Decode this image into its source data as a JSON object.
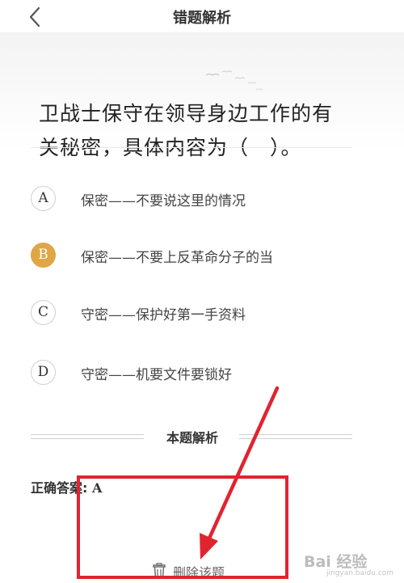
{
  "header": {
    "title": "错题解析",
    "back_icon": "chevron-left-icon"
  },
  "question": {
    "line1": "卫战士保守在领导身边工作的有",
    "line2": "关秘密，具体内容为（　）。"
  },
  "options": [
    {
      "letter": "A",
      "text": "保密——不要说这里的情况",
      "selected": false
    },
    {
      "letter": "B",
      "text": "保密——不要上反革命分子的当",
      "selected": true
    },
    {
      "letter": "C",
      "text": "守密——保护好第一手资料",
      "selected": false
    },
    {
      "letter": "D",
      "text": "守密——机要文件要锁好",
      "selected": false
    }
  ],
  "analysis": {
    "section_label": "本题解析",
    "answer_label": "正确答案:",
    "answer_value": "A"
  },
  "actions": {
    "delete_label": "删除该题",
    "delete_icon": "trash-icon"
  },
  "watermark": {
    "brand": "Bai  经验",
    "url": "jingyan.baidu.com"
  },
  "colors": {
    "selected_option": "#e0a646",
    "annotation": "#e0242f"
  }
}
